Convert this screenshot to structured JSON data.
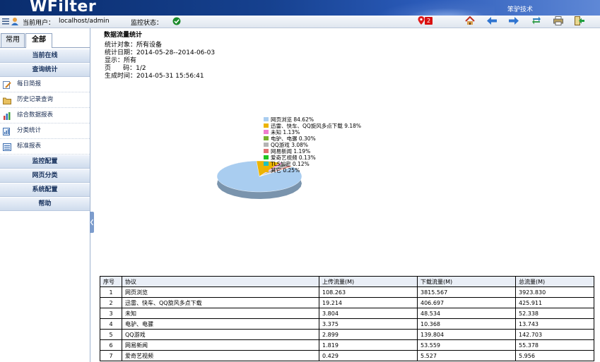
{
  "app": {
    "logo": "WFilter",
    "company": "笨驴技术"
  },
  "toolbar": {
    "user_label": "当前用户：",
    "user_value": "localhost/admin",
    "status_label": "监控状态：",
    "alert_count": "2"
  },
  "sidebar": {
    "tabs": [
      {
        "label": "常用"
      },
      {
        "label": "全部"
      }
    ],
    "sections": [
      {
        "label": "当前在线"
      },
      {
        "label": "查询统计"
      },
      {
        "label": "监控配置"
      },
      {
        "label": "网页分类"
      },
      {
        "label": "系统配置"
      },
      {
        "label": "帮助"
      }
    ],
    "items": [
      {
        "label": "每日简报"
      },
      {
        "label": "历史记录查询"
      },
      {
        "label": "综合数据报表"
      },
      {
        "label": "分类统计"
      },
      {
        "label": "标准报表"
      }
    ]
  },
  "report": {
    "title": "数据流量统计",
    "object": "统计对象：所有设备",
    "date": "统计日期：2014-05-28--2014-06-03",
    "display": "显示：所有",
    "page": "页      码：1/2",
    "generated": "生成时间：2014-05-31 15:56:41"
  },
  "chart_data": {
    "type": "pie",
    "series": [
      {
        "name": "网页浏览",
        "label": "网页浏览 84.62%",
        "value": 84.62,
        "color": "#a9cdf0"
      },
      {
        "name": "迅雷、快车、QQ旋风多点下载",
        "label": "迅雷、快车、QQ旋风多点下载 9.18%",
        "value": 9.18,
        "color": "#ecb404"
      },
      {
        "name": "未知",
        "label": "未知 1.13%",
        "value": 1.13,
        "color": "#f07cd0"
      },
      {
        "name": "电驴、电骡",
        "label": "电驴、电骡 0.30%",
        "value": 0.3,
        "color": "#79b030"
      },
      {
        "name": "QQ游戏",
        "label": "QQ游戏 3.08%",
        "value": 3.08,
        "color": "#b4b4b4"
      },
      {
        "name": "网易新闻",
        "label": "网易新闻 1.19%",
        "value": 1.19,
        "color": "#e07070"
      },
      {
        "name": "爱奇艺视频",
        "label": "爱奇艺视频 0.13%",
        "value": 0.13,
        "color": "#20c420"
      },
      {
        "name": "TLS加密",
        "label": "TLS加密 0.12%",
        "value": 0.12,
        "color": "#20c0c0"
      },
      {
        "name": "其它",
        "label": "其它 0.25%",
        "value": 0.25,
        "color": "#f0b000"
      }
    ]
  },
  "table": {
    "headers": [
      "序号",
      "协议",
      "上传流量(M)",
      "下载流量(M)",
      "总流量(M)"
    ],
    "rows": [
      [
        "1",
        "网页浏览",
        "108.263",
        "3815.567",
        "3923.830"
      ],
      [
        "2",
        "迅雷、快车、QQ旋风多点下载",
        "19.214",
        "406.697",
        "425.911"
      ],
      [
        "3",
        "未知",
        "3.804",
        "48.534",
        "52.338"
      ],
      [
        "4",
        "电驴、电骡",
        "3.375",
        "10.368",
        "13.743"
      ],
      [
        "5",
        "QQ游戏",
        "2.899",
        "139.804",
        "142.703"
      ],
      [
        "6",
        "网易新闻",
        "1.819",
        "53.559",
        "55.378"
      ],
      [
        "7",
        "爱奇艺视频",
        "0.429",
        "5.527",
        "5.956"
      ]
    ]
  }
}
